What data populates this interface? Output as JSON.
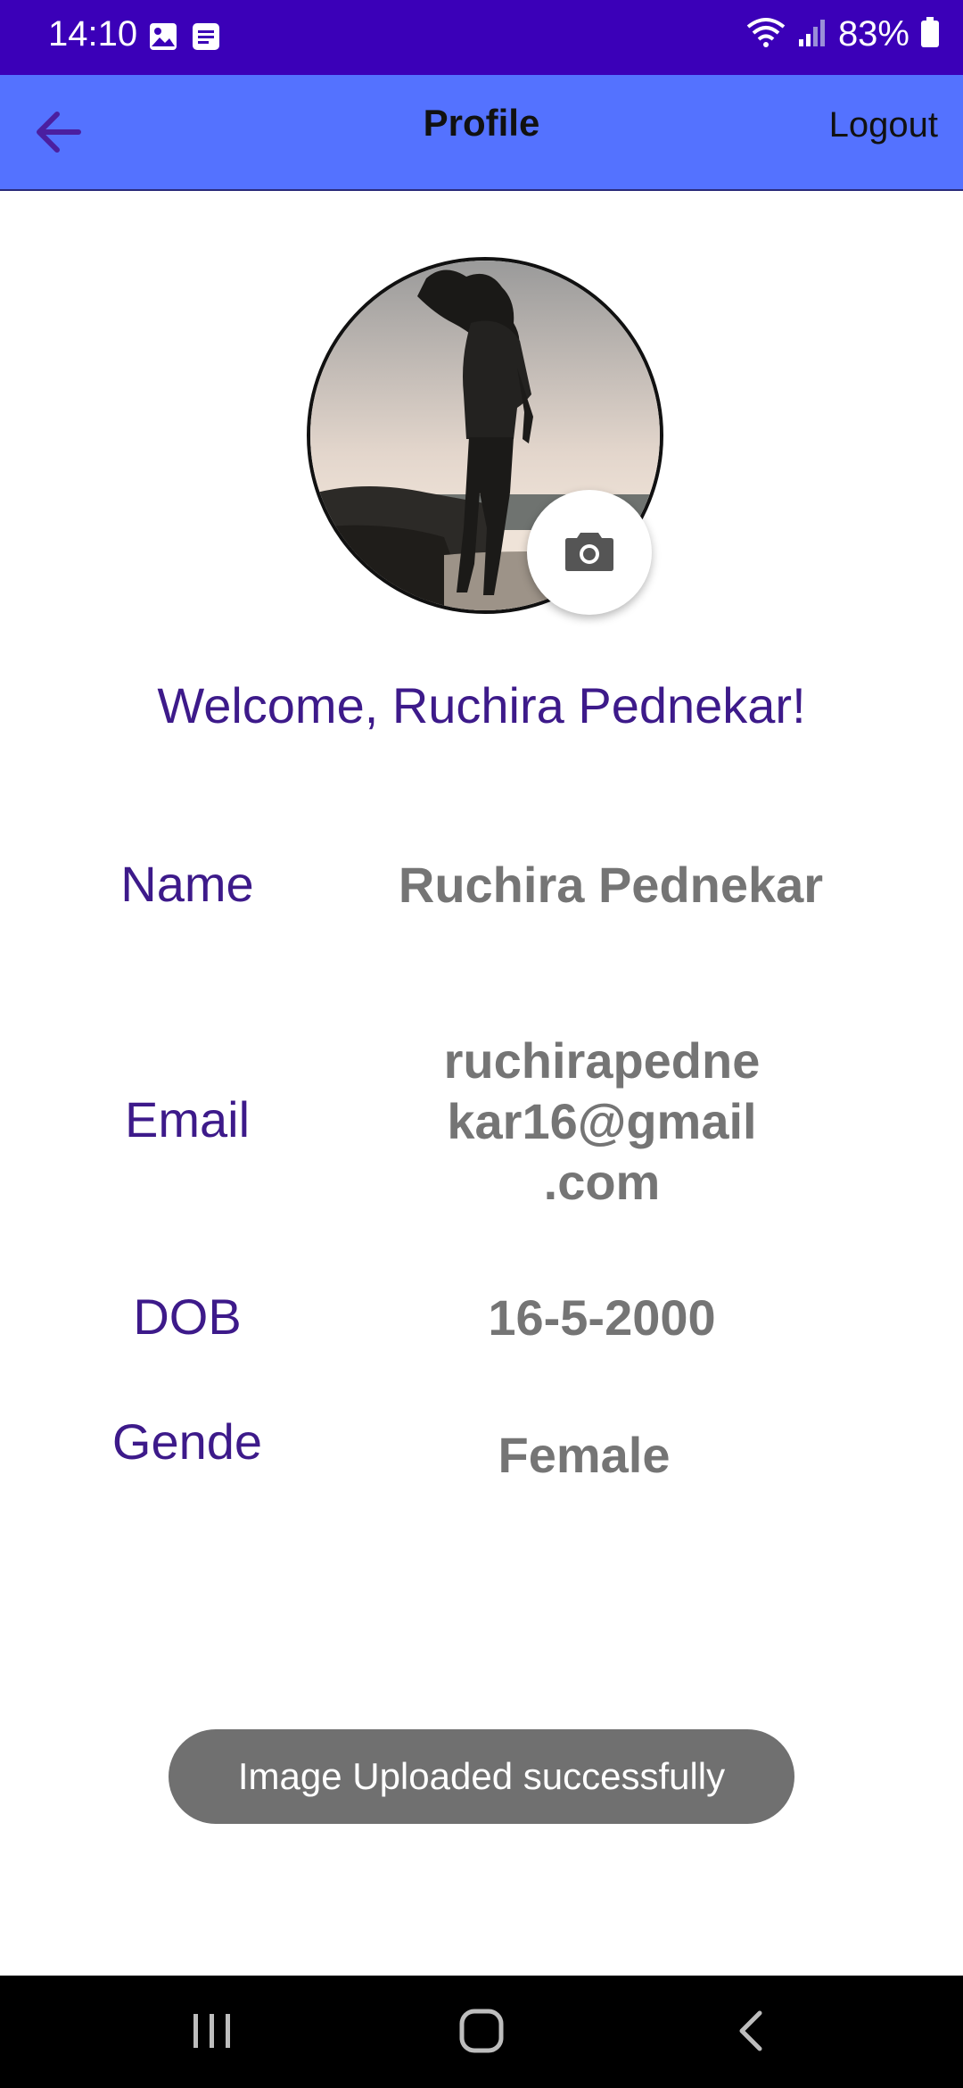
{
  "status_bar": {
    "time": "14:10",
    "battery": "83%",
    "icons": [
      "image-icon",
      "message-icon",
      "wifi-icon",
      "signal-icon",
      "battery-icon"
    ]
  },
  "app_bar": {
    "title": "Profile",
    "logout_label": "Logout",
    "background": "#5472ff"
  },
  "profile": {
    "welcome": "Welcome, Ruchira Pednekar!",
    "fields": {
      "name_label": "Name",
      "name_value": "Ruchira Pednekar",
      "email_label": "Email",
      "email_line1": "ruchirapedne",
      "email_line2": "kar16@gmail",
      "email_line3": ".com",
      "dob_label": "DOB",
      "dob_value": "16-5-2000",
      "gender_label": "Gende",
      "gender_value": "Female"
    }
  },
  "toast": {
    "message": "Image Uploaded successfully"
  },
  "colors": {
    "status_bar": "#3b00b8",
    "label_text": "#3d1a8a",
    "value_text": "#757575",
    "toast_bg": "#707070"
  }
}
